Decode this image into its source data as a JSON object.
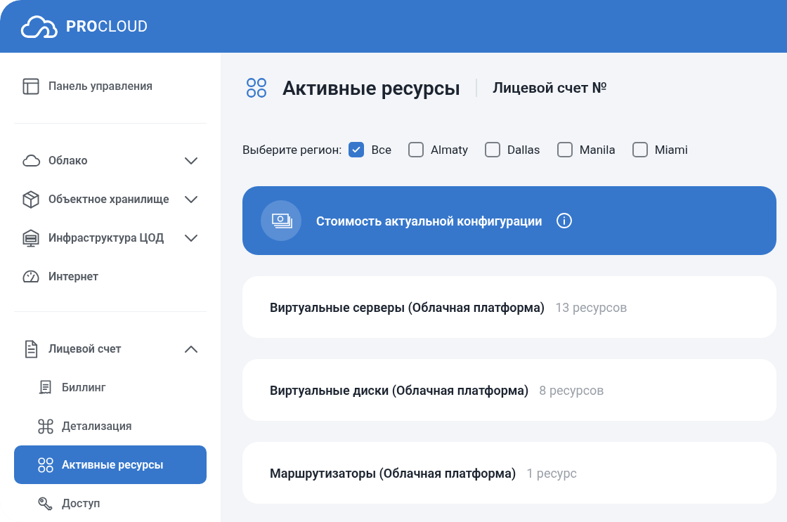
{
  "header": {
    "logo": "**PRO**CLOUD"
  },
  "sidebar": {
    "sections": [
      [
        {
          "label": "Панель управления",
          "kind": "item",
          "selected": false
        }
      ],
      [
        {
          "label": "Облако",
          "kind": "group",
          "expanded": false,
          "selected": false
        },
        {
          "label": "Объектное хранилище",
          "kind": "group",
          "expanded": false,
          "selected": false
        },
        {
          "label": "Инфраструктура ЦОД",
          "kind": "group",
          "expanded": false,
          "selected": false
        },
        {
          "label": "Интернет",
          "kind": "item",
          "selected": false
        }
      ],
      [
        {
          "label": "Лицевой счет",
          "kind": "group",
          "expanded": true,
          "selected": false,
          "children": [
            {
              "label": "Биллинг",
              "selected": false
            },
            {
              "label": "Детализация",
              "selected": false
            },
            {
              "label": "Активные ресурсы",
              "selected": true
            },
            {
              "label": "Доступ",
              "selected": false
            }
          ]
        }
      ]
    ]
  },
  "page": {
    "title": "Активные ресурсы",
    "subtitle": "Лицевой счет №"
  },
  "region_filter": {
    "label": "Выберите регион:",
    "options": [
      {
        "label": "Все",
        "checked": true
      },
      {
        "label": "Almaty",
        "checked": false
      },
      {
        "label": "Dallas",
        "checked": false
      },
      {
        "label": "Manila",
        "checked": false
      },
      {
        "label": "Miami",
        "checked": false
      }
    ]
  },
  "cost_banner": {
    "title": "Стоимость актуальной конфигурации"
  },
  "resources": [
    {
      "title": "Виртуальные серверы (Облачная платформа)",
      "count": "13 ресурсов"
    },
    {
      "title": "Виртуальные диски (Облачная платформа)",
      "count": "8 ресурсов"
    },
    {
      "title": "Маршрутизаторы (Облачная платформа)",
      "count": "1 ресурс"
    }
  ]
}
